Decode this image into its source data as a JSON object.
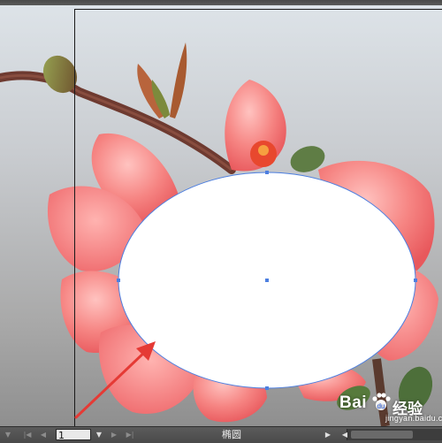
{
  "document": {
    "shape_tool_label": "椭圆",
    "page_number": "1"
  },
  "statusbar": {
    "nav_icons": [
      "first-page-icon",
      "previous-page-icon",
      "next-page-icon",
      "last-page-icon"
    ],
    "scroll_arrow_icon": "scroll-left-icon"
  },
  "watermark": {
    "brand": "Bai",
    "paw_icon": "baidu-paw-icon",
    "name": "经验",
    "url": "jingyan.baidu.com"
  },
  "colors": {
    "ellipse_fill": "#ffffff",
    "selection_blue": "#4d7fe0",
    "petal_pink": "#f27a7c",
    "arrow_red": "#e53a35",
    "statusbar": "#525252"
  }
}
